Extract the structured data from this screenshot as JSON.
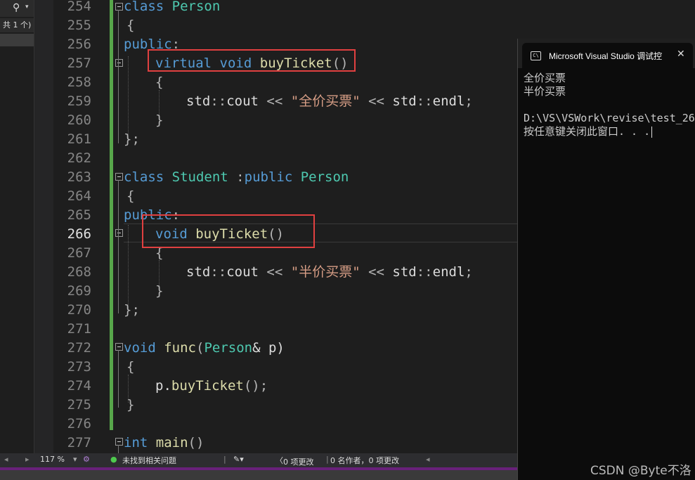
{
  "sidebar": {
    "search_icon": "search-icon",
    "results_count": "共 1 个)"
  },
  "editor": {
    "current_line": "266",
    "line_numbers": [
      "254",
      "255",
      "256",
      "257",
      "258",
      "259",
      "260",
      "261",
      "262",
      "263",
      "264",
      "265",
      "266",
      "267",
      "268",
      "269",
      "270",
      "271",
      "272",
      "273",
      "274",
      "275",
      "276",
      "277"
    ],
    "code": {
      "l254_a": "class",
      "l254_b": "Person",
      "l255": "{",
      "l256_a": "public",
      "l256_b": ":",
      "l257_a": "virtual",
      "l257_b": "void",
      "l257_c": "buyTicket",
      "l257_d": "()",
      "l258": "{",
      "l259_a": "std",
      "l259_b": "::",
      "l259_c": "cout",
      "l259_d": " << ",
      "l259_e": "\"全价买票\"",
      "l259_f": " << ",
      "l259_g": "std",
      "l259_h": "::",
      "l259_i": "endl",
      "l259_j": ";",
      "l260": "}",
      "l261": "};",
      "l263_a": "class",
      "l263_b": "Student",
      "l263_c": " :",
      "l263_d": "public",
      "l263_e": "Person",
      "l264": "{",
      "l265_a": "public",
      "l265_b": ":",
      "l266_a": "void",
      "l266_b": "buyTicket",
      "l266_c": "()",
      "l267": "{",
      "l268_a": "std",
      "l268_b": "::",
      "l268_c": "cout",
      "l268_d": " << ",
      "l268_e": "\"半价买票\"",
      "l268_f": " << ",
      "l268_g": "std",
      "l268_h": "::",
      "l268_i": "endl",
      "l268_j": ";",
      "l269": "}",
      "l270": "};",
      "l272_a": "void",
      "l272_b": "func",
      "l272_c": "(",
      "l272_d": "Person",
      "l272_e": "& p)",
      "l273": "{",
      "l274_a": "p.",
      "l274_b": "buyTicket",
      "l274_c": "();",
      "l275": "}",
      "l277_a": "int",
      "l277_b": "main",
      "l277_c": "()"
    }
  },
  "statusbar": {
    "zoom": "117 %",
    "issues": "未找到相关问题",
    "changes": "0 项更改",
    "authors": "0 名作者，0 项更改"
  },
  "console": {
    "title": "Microsoft Visual Studio 调试控",
    "lines": [
      "全价买票",
      "半价买票",
      "",
      "D:\\VS\\VSWork\\revise\\test_26",
      "按任意键关闭此窗口. . ."
    ]
  },
  "watermark": "CSDN @Byte不洛",
  "colors": {
    "keyword": "#569cd6",
    "type": "#4ec9b0",
    "function": "#dcdcaa",
    "string": "#d69d85",
    "change_bar": "#57a64a",
    "highlight_box": "#e04040"
  }
}
